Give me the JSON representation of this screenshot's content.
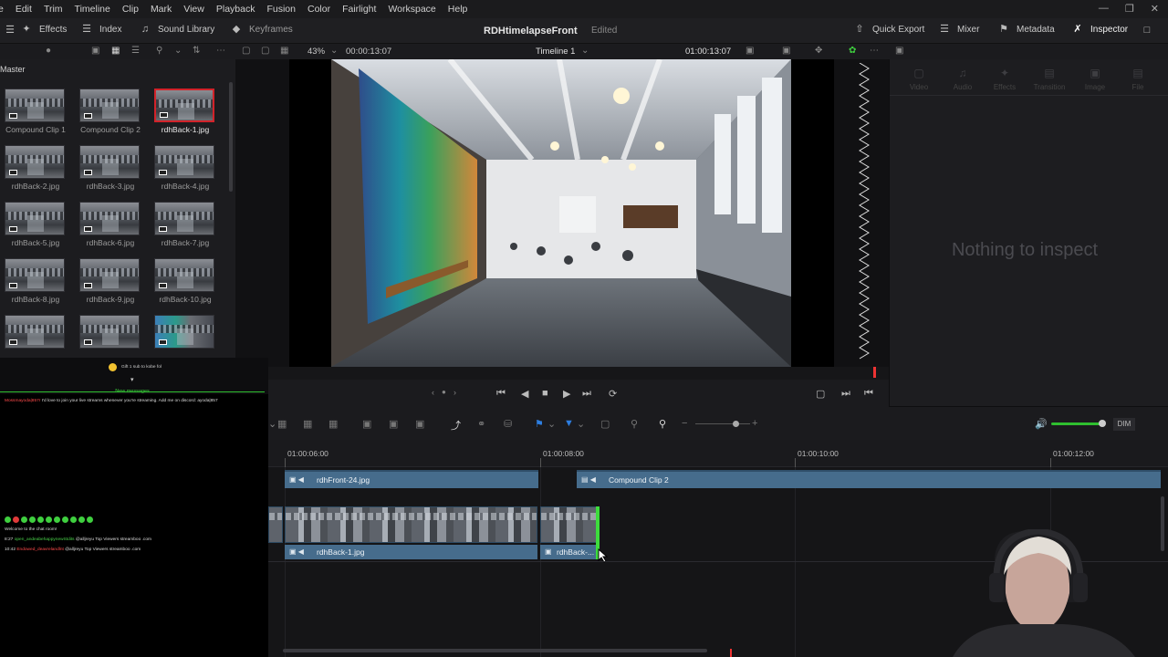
{
  "menu": [
    "e",
    "Edit",
    "Trim",
    "Timeline",
    "Clip",
    "Mark",
    "View",
    "Playback",
    "Fusion",
    "Color",
    "Fairlight",
    "Workspace",
    "Help"
  ],
  "toolbar": {
    "effects": "Effects",
    "index": "Index",
    "sound_library": "Sound Library",
    "keyframes": "Keyframes",
    "project_title": "RDHtimelapseFront",
    "project_status": "Edited",
    "quick_export": "Quick Export",
    "mixer": "Mixer",
    "metadata": "Metadata",
    "inspector": "Inspector"
  },
  "viewer": {
    "zoom": "43%",
    "source_timecode": "00:00:13:07",
    "timeline_name": "Timeline 1",
    "record_timecode": "01:00:13:07"
  },
  "media_pool": {
    "folder": "Master",
    "clips": [
      {
        "name": "Compound Clip 1",
        "selected": false
      },
      {
        "name": "Compound Clip 2",
        "selected": false
      },
      {
        "name": "rdhBack-1.jpg",
        "selected": true
      },
      {
        "name": "rdhBack-2.jpg",
        "selected": false
      },
      {
        "name": "rdhBack-3.jpg",
        "selected": false
      },
      {
        "name": "rdhBack-4.jpg",
        "selected": false
      },
      {
        "name": "rdhBack-5.jpg",
        "selected": false
      },
      {
        "name": "rdhBack-6.jpg",
        "selected": false
      },
      {
        "name": "rdhBack-7.jpg",
        "selected": false
      },
      {
        "name": "rdhBack-8.jpg",
        "selected": false
      },
      {
        "name": "rdhBack-9.jpg",
        "selected": false
      },
      {
        "name": "rdhBack-10.jpg",
        "selected": false
      }
    ]
  },
  "inspector": {
    "tabs": [
      "Video",
      "Audio",
      "Effects",
      "Transition",
      "Image",
      "File"
    ],
    "empty_message": "Nothing to inspect"
  },
  "chat": {
    "tip": "Gift 1 sub to kobe fol",
    "new_messages": "New messages",
    "first_user": "Mossmayoda|857r",
    "first_message": "I'd love to join your live streams whenever you're streaming. Add me on discord: ayoda|857",
    "welcome": "Welcome to the chat room!",
    "line1_time": "8:27",
    "line1_user": "open_andeabehappynewStdits",
    "line1_text": "@alljreyu Top Viewers streamboo .com",
    "line2_time": "10:42",
    "line2_user": "Endowed_deavrelandlnt",
    "line2_text": "@alljreyu Top Viewers streamboo .com"
  },
  "timeline_controls": {
    "dim": "DIM"
  },
  "timeline": {
    "ruler": [
      "01:00:06:00",
      "01:00:08:00",
      "01:00:10:00",
      "01:00:12:00"
    ],
    "v2_clips": [
      "rdhFront-24.jpg",
      "Compound Clip 2"
    ],
    "v1_clips": [
      "rdhBack-1.jpg",
      "rdhBack-..."
    ]
  },
  "colors": {
    "accent_red": "#d2232a",
    "clip_blue": "#466c8c",
    "trim_green": "#3ddc3d"
  }
}
